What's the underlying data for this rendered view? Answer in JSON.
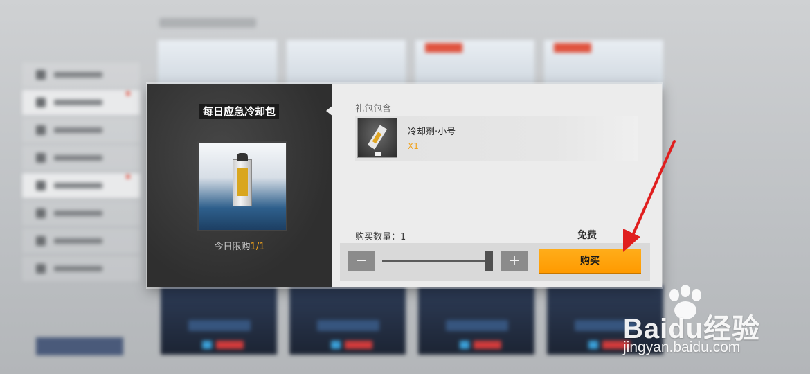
{
  "dialog": {
    "pack_title": "每日应急冷却包",
    "limit_prefix": "今日限购",
    "limit_count": "1/1",
    "contents_label": "礼包包含",
    "item": {
      "name": "冷却剂·小号",
      "quantity": "X1"
    },
    "quantity_label": "购买数量：1",
    "price": "免费",
    "minus_symbol": "−",
    "plus_symbol": "+",
    "buy_label": "购买",
    "slider_level": 1.0
  },
  "watermark": {
    "brand": "Bai",
    "brand_du": "du",
    "brand_suffix": "经验",
    "url": "jingyan.baidu.com"
  },
  "colors": {
    "accent_orange": "#ff9f0a",
    "limit_orange": "#f0a21c",
    "annotation_red": "#e01e1e"
  }
}
